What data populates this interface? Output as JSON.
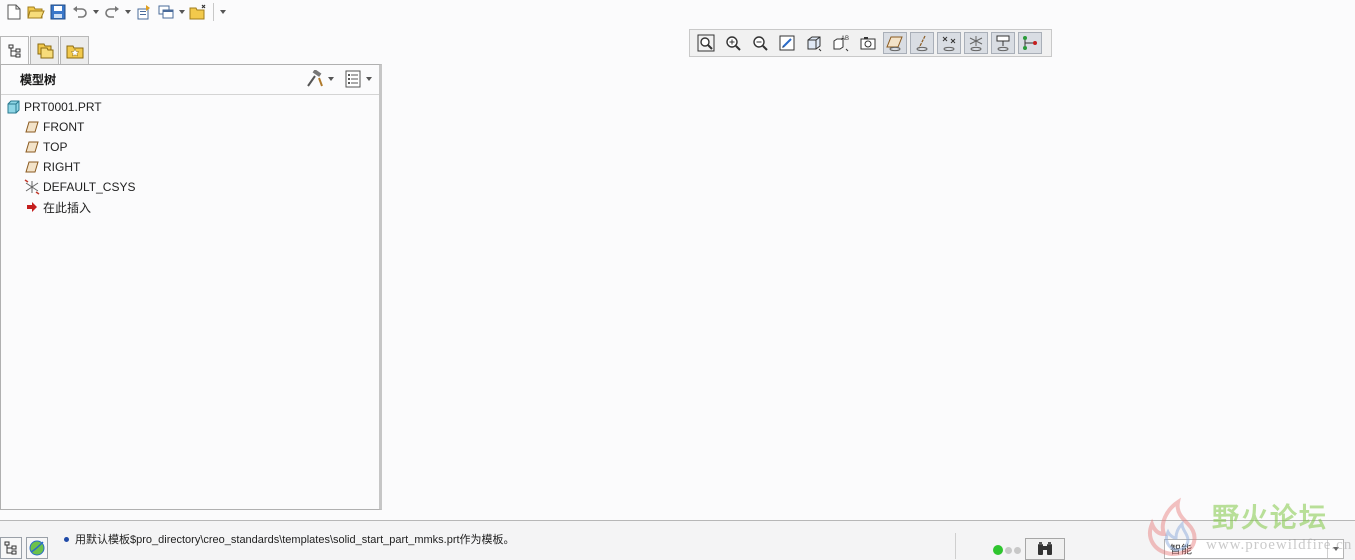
{
  "quick_access": {
    "buttons": [
      "new-icon",
      "open-icon",
      "save-icon",
      "undo-icon",
      "redo-icon",
      "regenerate-icon",
      "windows-icon",
      "close-window-icon",
      "customize-icon"
    ]
  },
  "panel_tabs": [
    "model-tree-tab",
    "folder-browser-tab",
    "favorites-tab"
  ],
  "model_tree": {
    "title": "模型树",
    "items": [
      {
        "label": "PRT0001.PRT",
        "icon": "part-icon"
      },
      {
        "label": "FRONT",
        "icon": "datum-plane-icon"
      },
      {
        "label": "TOP",
        "icon": "datum-plane-icon"
      },
      {
        "label": "RIGHT",
        "icon": "datum-plane-icon"
      },
      {
        "label": "DEFAULT_CSYS",
        "icon": "coordinate-system-icon"
      },
      {
        "label": "在此插入",
        "icon": "insert-here-arrow-icon"
      }
    ]
  },
  "graphics_toolbar": {
    "buttons": [
      "refit-icon",
      "zoom-in-icon",
      "zoom-out-icon",
      "repaint-icon",
      "display-style-icon",
      "saved-orientations-icon",
      "view-manager-icon",
      "plane-display-icon",
      "axis-display-icon",
      "point-display-icon",
      "csys-display-icon",
      "annotation-display-icon",
      "spin-center-icon"
    ]
  },
  "status": {
    "message": "用默认模板$pro_directory\\creo_standards\\templates\\solid_start_part_mmks.prt作为模板。",
    "filter_value": "智能",
    "accent": "#1f4aa8",
    "light_on": "#2fc52f"
  },
  "watermark": {
    "title": "野火论坛",
    "url": "www.proewildfire.cn"
  }
}
